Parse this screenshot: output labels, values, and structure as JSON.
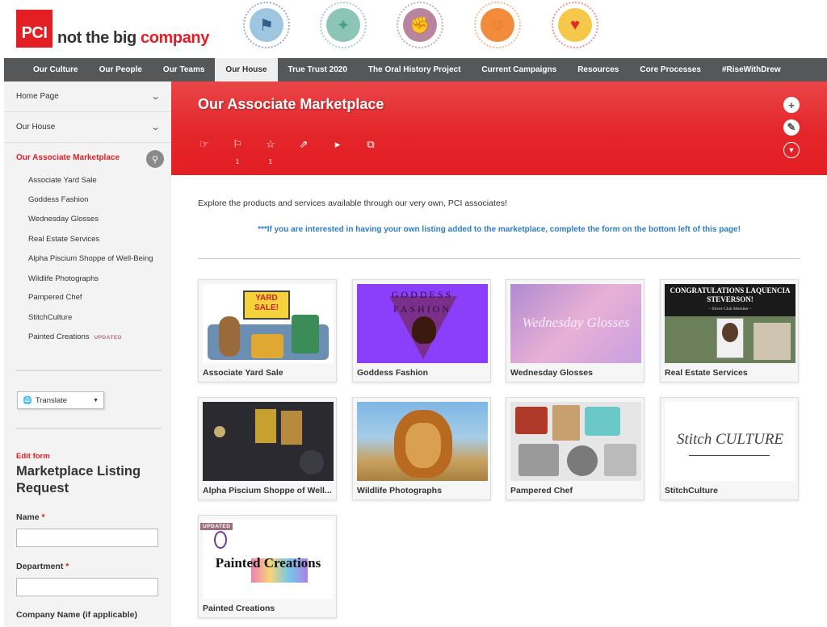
{
  "header": {
    "logo_mark": "PCI",
    "tag_red": "not the big",
    "tag_dark": " company",
    "badges": [
      {
        "name": "flag-person-badge",
        "color": "#2f5f8a",
        "bg": "#9ec6e0",
        "glyph": "⚑"
      },
      {
        "name": "lightbulb-badge",
        "color": "#4e9c8a",
        "bg": "#8cc4b6",
        "glyph": "💡"
      },
      {
        "name": "fist-badge",
        "color": "#8c5a7a",
        "bg": "#b8849e",
        "glyph": "✊"
      },
      {
        "name": "celebrate-badge",
        "color": "#e8782c",
        "bg": "#f28c3c",
        "glyph": "☺"
      },
      {
        "name": "heart-hands-badge",
        "color": "#e32a2a",
        "bg": "#f5c84a",
        "glyph": "♥"
      }
    ]
  },
  "nav": [
    "Our Culture",
    "Our People",
    "Our Teams",
    "Our House",
    "True Trust 2020",
    "The Oral History Project",
    "Current Campaigns",
    "Resources",
    "Core Processes",
    "#RiseWithDrew"
  ],
  "nav_active_index": 3,
  "sidebar": {
    "home": "Home Page",
    "house": "Our House",
    "current": "Our Associate Marketplace",
    "subitems": [
      "Associate Yard Sale",
      "Goddess Fashion",
      "Wednesday Glosses",
      "Real Estate Services",
      "Alpha Piscium Shoppe of Well-Being",
      "Wildlife Photographs",
      "Pampered Chef",
      "StitchCulture",
      "Painted Creations"
    ],
    "updated_tag": "UPDATED",
    "translate": "Translate"
  },
  "form": {
    "edit_link": "Edit form",
    "title": "Marketplace Listing Request",
    "fields": [
      {
        "label": "Name",
        "required": "*"
      },
      {
        "label": "Department",
        "required": "*"
      },
      {
        "label": "Company Name (if applicable)",
        "required": ""
      }
    ]
  },
  "banner": {
    "title": "Our Associate Marketplace",
    "actions": [
      {
        "name": "like-icon",
        "glyph": "👍",
        "count": ""
      },
      {
        "name": "flag-icon",
        "glyph": "⚐",
        "count": "1"
      },
      {
        "name": "star-icon",
        "glyph": "☆",
        "count": "1"
      },
      {
        "name": "share-icon",
        "glyph": "⇗",
        "count": ""
      },
      {
        "name": "announce-icon",
        "glyph": "📢",
        "count": ""
      },
      {
        "name": "copy-icon",
        "glyph": "⧉",
        "count": ""
      }
    ]
  },
  "content": {
    "intro": "Explore the products and services available through our very own, PCI associates!",
    "notice": "***If you are interested in having your own listing added to the marketplace, complete the form on the bottom left of this page!"
  },
  "cards": [
    {
      "label": "Associate Yard Sale",
      "img_text": "YARD SALE!"
    },
    {
      "label": "Goddess Fashion",
      "img_text": "GODDESS FASHION"
    },
    {
      "label": "Wednesday Glosses",
      "img_text": "Wednesday Glosses"
    },
    {
      "label": "Real Estate Services",
      "img_text": "CONGRATULATIONS LAQUENCIA STEVERSON!",
      "img_sub": "- Silver Club Member -"
    },
    {
      "label": "Alpha Piscium Shoppe of Well...",
      "img_text": ""
    },
    {
      "label": "Wildlife Photographs",
      "img_text": ""
    },
    {
      "label": "Pampered Chef",
      "img_text": ""
    },
    {
      "label": "StitchCulture",
      "img_text": "Stitch CULTURE"
    },
    {
      "label": "Painted Creations",
      "img_text": "Painted Creations",
      "updated": "UPDATED"
    }
  ]
}
